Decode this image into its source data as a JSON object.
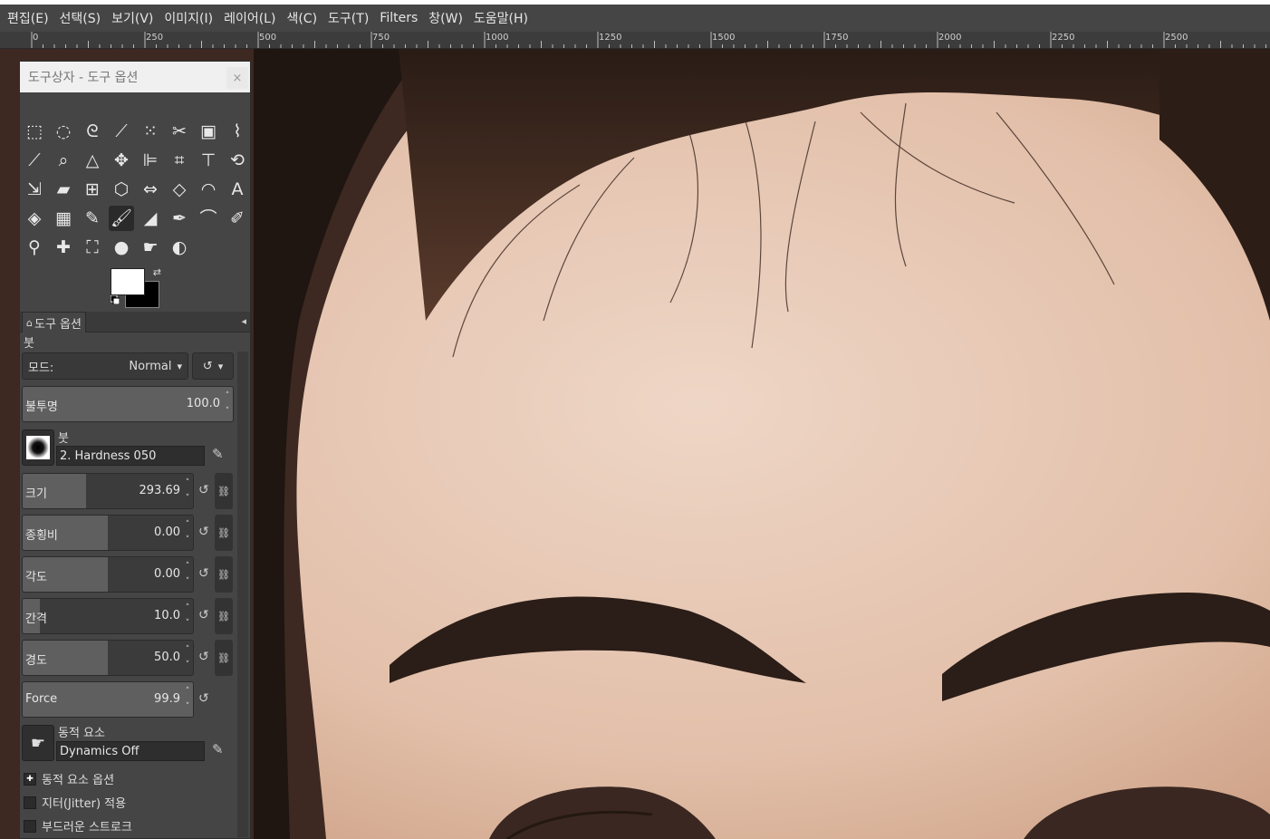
{
  "menu": [
    "편집(E)",
    "선택(S)",
    "보기(V)",
    "이미지(I)",
    "레이어(L)",
    "색(C)",
    "도구(T)",
    "Filters",
    "창(W)",
    "도움말(H)"
  ],
  "ruler": {
    "labels": [
      "0",
      "250",
      "500",
      "750",
      "1000",
      "1250",
      "1500",
      "1750",
      "2000",
      "2250",
      "2500"
    ]
  },
  "dock": {
    "title": "도구상자 - 도구 옵션",
    "close": "×"
  },
  "tool_options": {
    "tab_label": "도구 옵션",
    "tool_name": "붓",
    "mode_label": "모드:",
    "mode_value": "Normal",
    "opacity": {
      "label": "불투명",
      "value": "100.0"
    },
    "brush_label": "붓",
    "brush_name": "2. Hardness 050",
    "size": {
      "label": "크기",
      "value": "293.69",
      "fill": 0.37
    },
    "aspect": {
      "label": "종횡비",
      "value": "0.00",
      "fill": 0.5
    },
    "angle": {
      "label": "각도",
      "value": "0.00",
      "fill": 0.5
    },
    "spacing": {
      "label": "간격",
      "value": "10.0",
      "fill": 0.1
    },
    "hardness": {
      "label": "경도",
      "value": "50.0",
      "fill": 0.5
    },
    "force": {
      "label": "Force",
      "value": "99.9",
      "fill": 1.0
    },
    "dynamics_label": "동적 요소",
    "dynamics_name": "Dynamics Off",
    "dynamics_options": "동적 요소 옵션",
    "jitter": "지터(Jitter) 적용",
    "smooth": "부드러운 스트로크"
  }
}
